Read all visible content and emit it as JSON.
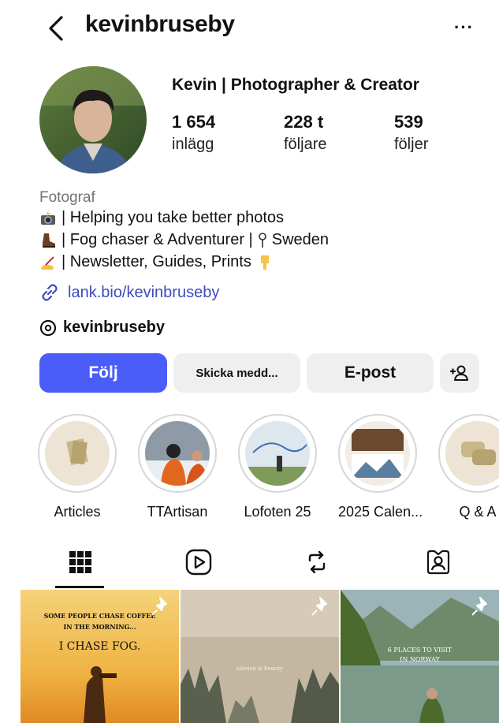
{
  "header": {
    "username": "kevinbruseby",
    "more_label": "···"
  },
  "profile": {
    "display_name": "Kevin | Photographer & Creator",
    "stats": [
      {
        "value": "1 654",
        "label": "inlägg"
      },
      {
        "value": "228 t",
        "label": "följare"
      },
      {
        "value": "539",
        "label": "följer"
      }
    ],
    "category": "Fotograf",
    "bio": [
      {
        "emoji": "camera-flash-icon",
        "text": "| Helping you take better photos"
      },
      {
        "emoji": "hiking-boot-icon",
        "text": "| Fog chaser & Adventurer | ",
        "pin_text": "Sweden"
      },
      {
        "emoji": "writing-hand-icon",
        "text": "| Newsletter, Guides, Prints",
        "tail_emoji": "pointing-down-icon"
      }
    ],
    "link": "lank.bio/kevinbruseby",
    "threads_handle": "kevinbruseby"
  },
  "buttons": {
    "follow": "Följ",
    "message": "Skicka medd...",
    "email": "E-post"
  },
  "highlights": [
    {
      "label": "Articles"
    },
    {
      "label": "TTArtisan"
    },
    {
      "label": "Lofoten 25"
    },
    {
      "label": "2025 Calen..."
    },
    {
      "label": "Q & A"
    }
  ],
  "tabs": [
    "grid-icon",
    "reels-icon",
    "reposts-icon",
    "tagged-icon"
  ],
  "posts": [
    {
      "text_top": "SOME PEOPLE CHASE COFFEE",
      "text_top2": "IN THE MORNING...",
      "text_main": "I CHASE FOG."
    },
    {
      "text_main": "silence is beauty"
    },
    {
      "text_top": "6 PLACES TO VISIT",
      "text_top2": "IN NORWAY"
    }
  ],
  "colors": {
    "accent": "#4a5df9",
    "link": "#3c4bbf",
    "muted": "#737373",
    "button_bg": "#efefef"
  }
}
